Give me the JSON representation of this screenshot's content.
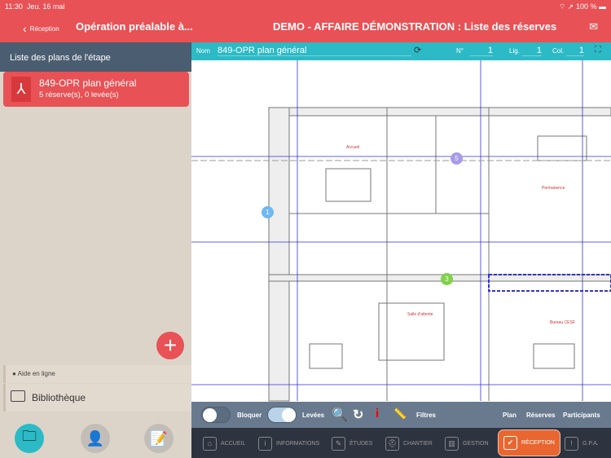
{
  "status": {
    "time": "11:30",
    "date": "Jeu. 16 mai",
    "battery": "100 %"
  },
  "nav": {
    "back_label": "Réception",
    "subtitle": "Opération préalable à...",
    "title": "DEMO - AFFAIRE DÉMONSTRATION : Liste des réserves"
  },
  "sidebar": {
    "header": "Liste des plans de l'étape",
    "plans": [
      {
        "name": "849-OPR plan général",
        "count": "5 réserve(s), 0 levée(s)"
      }
    ],
    "help": "Aide en ligne",
    "library": "Bibliothèque",
    "tabs": [
      "folder-icon",
      "user-icon",
      "notepad-icon"
    ]
  },
  "plan_bar": {
    "nom_label": "Nom",
    "nom_value": "849-OPR plan général",
    "no_label": "N°",
    "no_value": "1",
    "lig_label": "Lig.",
    "lig_value": "1",
    "col_label": "Col.",
    "col_value": "1"
  },
  "markers": [
    {
      "label": "1",
      "color": "#6fb8f0"
    },
    {
      "label": "5",
      "color": "#a99be8"
    },
    {
      "label": "3",
      "color": "#7fd24a"
    }
  ],
  "toolbar": {
    "bloquer": "Bloquer",
    "bloquer_on": false,
    "levees": "Levées",
    "levees_on": true,
    "filtres": "Filtres",
    "plan": "Plan",
    "reserves": "Réserves",
    "participants": "Participants"
  },
  "bottom_nav": [
    {
      "label": "ACCUEIL",
      "icon": "⌂"
    },
    {
      "label": "INFORMATIONS",
      "icon": "i"
    },
    {
      "label": "ÉTUDES",
      "icon": "✎"
    },
    {
      "label": "CHANTIER",
      "icon": "⛑"
    },
    {
      "label": "GESTION",
      "icon": "▥"
    },
    {
      "label": "RÉCEPTION",
      "icon": "✔",
      "active": true
    },
    {
      "label": "G.P.A.",
      "icon": "!"
    }
  ],
  "colors": {
    "brand": "#e85155",
    "teal": "#2bbac6",
    "active": "#e8662f"
  }
}
